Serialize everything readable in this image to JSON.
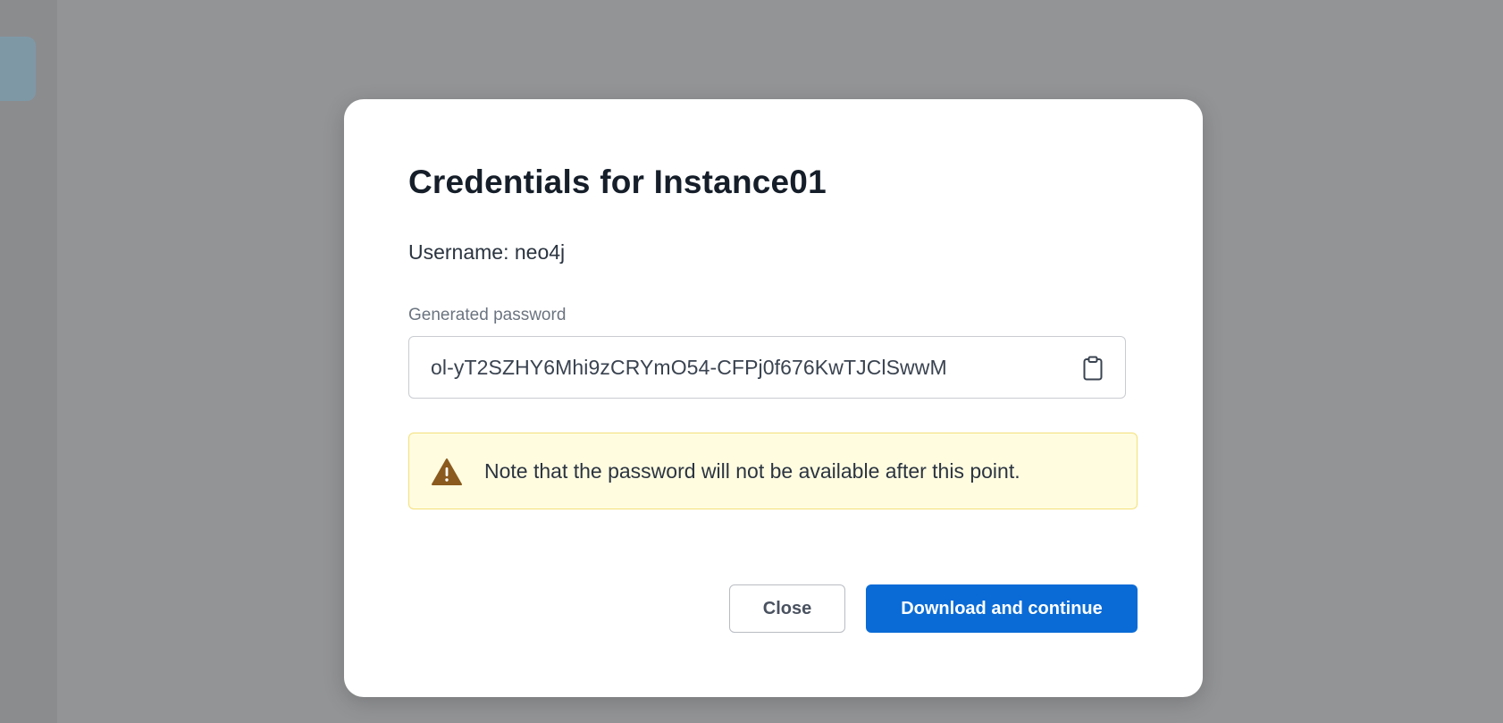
{
  "dialog": {
    "title": "Credentials for Instance01",
    "username_line": "Username: neo4j",
    "password_label": "Generated password",
    "password_value": "ol-yT2SZHY6Mhi9zCRYmO54-CFPj0f676KwTJClSwwM",
    "copy_icon": "clipboard-icon",
    "notice": {
      "icon": "warning-triangle-icon",
      "text": "Note that the password will not be available after this point.",
      "background": "#fffce0",
      "border": "#f3e07a",
      "icon_color": "#8a5a1e"
    },
    "buttons": {
      "close_label": "Close",
      "primary_label": "Download and continue"
    }
  },
  "colors": {
    "overlay": "#939496",
    "primary": "#0a6bd6",
    "title_text": "#151e29"
  }
}
